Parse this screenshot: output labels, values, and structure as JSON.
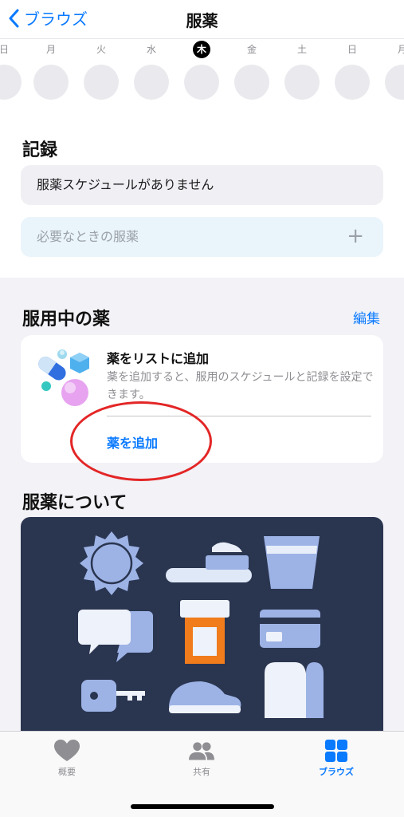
{
  "nav": {
    "back_label": "ブラウズ",
    "title": "服薬"
  },
  "week": {
    "days": [
      "日",
      "月",
      "火",
      "水",
      "木",
      "金",
      "土",
      "日",
      "月"
    ],
    "today_index": 4
  },
  "log": {
    "title": "記録",
    "no_schedule": "服薬スケジュールがありません",
    "as_needed": "必要なときの服薬"
  },
  "meds": {
    "title": "服用中の薬",
    "edit_label": "編集",
    "card": {
      "title": "薬をリストに追加",
      "description": "薬を追加すると、服用のスケジュールと記録を設定できます。",
      "add_label": "薬を追加"
    }
  },
  "about": {
    "title": "服薬について"
  },
  "tabbar": {
    "items": [
      {
        "label": "概要",
        "icon": "heart-icon"
      },
      {
        "label": "共有",
        "icon": "people-icon"
      },
      {
        "label": "ブラウズ",
        "icon": "grid-icon",
        "active": true
      }
    ]
  },
  "colors": {
    "accent": "#0a7aff",
    "annotation": "#e32626",
    "banner_bg": "#2a3550"
  }
}
